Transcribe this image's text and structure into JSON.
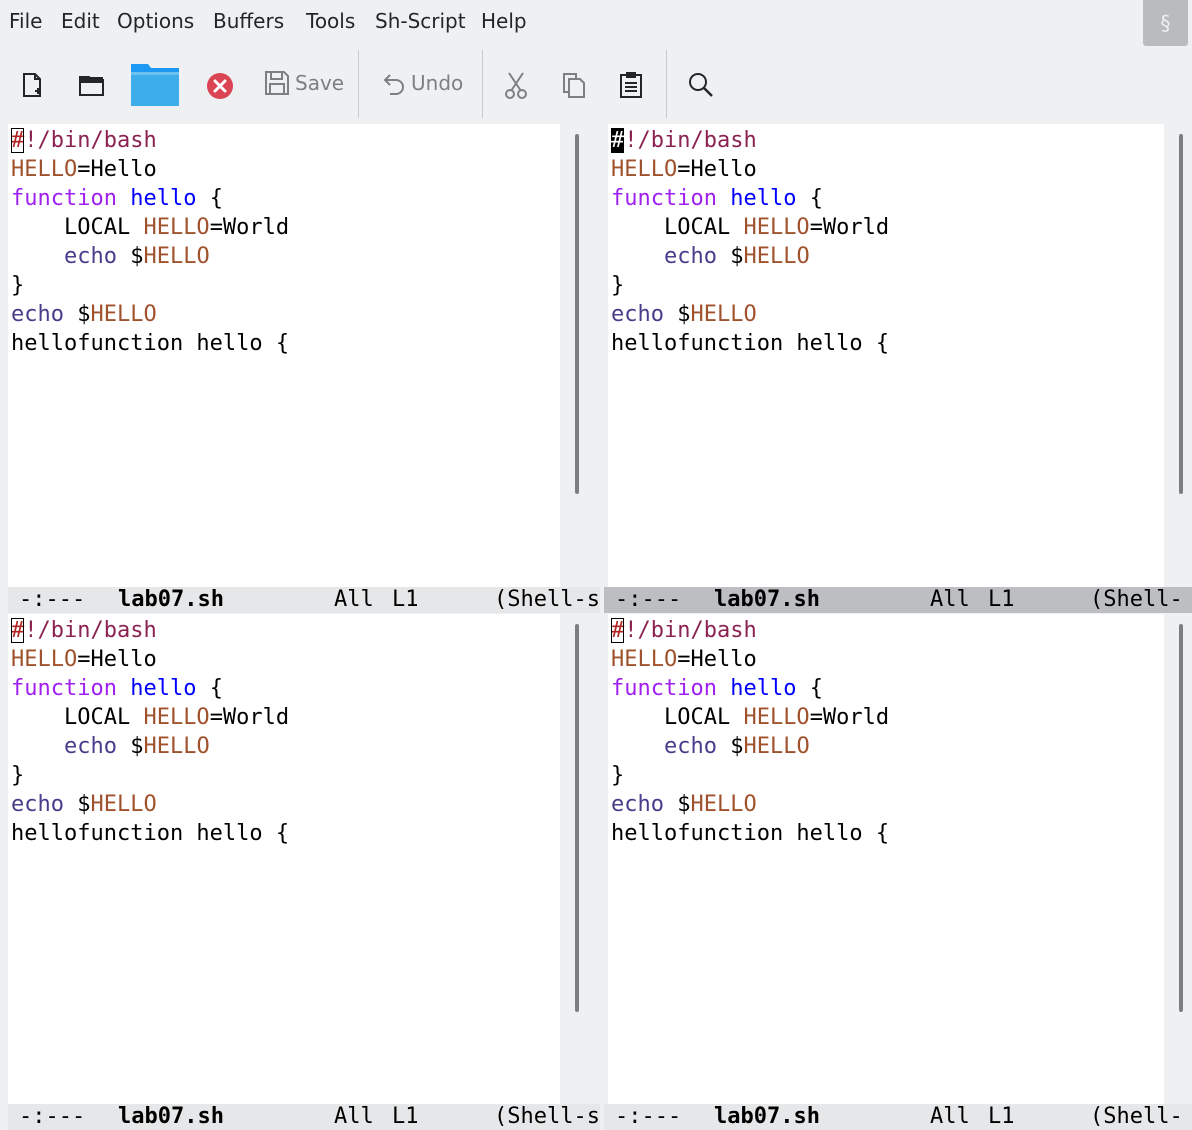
{
  "menu": {
    "items": [
      "File",
      "Edit",
      "Options",
      "Buffers",
      "Tools",
      "Sh-Script",
      "Help"
    ],
    "corner_glyph": "§"
  },
  "toolbar": {
    "save_label": "Save",
    "undo_label": "Undo",
    "icons": [
      "new-file-icon",
      "open-folder-icon",
      "dired-folder-icon",
      "close-icon",
      "save-icon",
      "undo-icon",
      "cut-icon",
      "copy-icon",
      "paste-icon",
      "search-icon"
    ],
    "close_color": "#da4453",
    "folder_color": "#3daee9"
  },
  "buffer": {
    "lines": [
      "#!/bin/bash",
      "HELLO=Hello",
      "function hello {",
      "    LOCAL HELLO=World",
      "    echo $HELLO",
      "}",
      "echo $HELLO",
      "hellofunction hello {"
    ]
  },
  "panes": [
    {
      "status": "-:---",
      "buffer_name": "lab07.sh",
      "position": "All",
      "line": "L1",
      "mode": "(Shell-s",
      "active": false
    },
    {
      "status": "-:---",
      "buffer_name": "lab07.sh",
      "position": "All",
      "line": "L1",
      "mode": "(Shell-",
      "active": true
    },
    {
      "status": "-:---",
      "buffer_name": "lab07.sh",
      "position": "All",
      "line": "L1",
      "mode": "(Shell-s",
      "active": false
    },
    {
      "status": "-:---",
      "buffer_name": "lab07.sh",
      "position": "All",
      "line": "L1",
      "mode": "(Shell-",
      "active": false
    }
  ],
  "colors": {
    "comment": "#b22222",
    "string": "#8b2252",
    "builtin": "#483d8b",
    "keyword": "#a020f0",
    "function_name": "#0000ff",
    "variable": "#a0522d",
    "modeline_active": "#bcbec1",
    "modeline_inactive": "#e6e7e8"
  }
}
